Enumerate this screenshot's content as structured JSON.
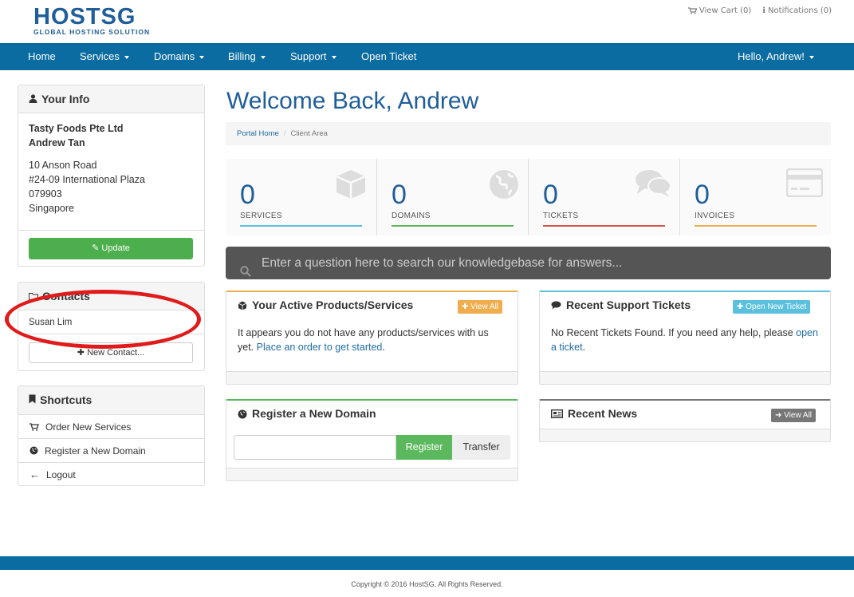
{
  "logo": {
    "main": "HOSTSG",
    "sub": "GLOBAL HOSTING SOLUTION"
  },
  "toplinks": {
    "cart": "View Cart (0)",
    "notifications": "Notifications (0)"
  },
  "nav": {
    "items": [
      {
        "label": "Home"
      },
      {
        "label": "Services"
      },
      {
        "label": "Domains"
      },
      {
        "label": "Billing"
      },
      {
        "label": "Support"
      },
      {
        "label": "Open Ticket"
      }
    ],
    "user": "Hello, Andrew!"
  },
  "your_info": {
    "title": "Your Info",
    "company": "Tasty Foods Pte Ltd",
    "name": "Andrew Tan",
    "address1": "10 Anson Road",
    "address2": "#24-09 International Plaza",
    "postcode": "079903",
    "country": "Singapore",
    "update_label": "Update"
  },
  "contacts": {
    "title": "Contacts",
    "items": [
      {
        "name": "Susan Lim"
      }
    ],
    "new_label": "New Contact..."
  },
  "shortcuts": {
    "title": "Shortcuts",
    "items": [
      {
        "label": "Order New Services",
        "icon": "cart-icon"
      },
      {
        "label": "Register a New Domain",
        "icon": "globe-icon"
      },
      {
        "label": "Logout",
        "icon": "arrow-left-icon"
      }
    ]
  },
  "welcome": "Welcome Back, Andrew",
  "breadcrumb": {
    "home": "Portal Home",
    "current": "Client Area"
  },
  "stats": [
    {
      "value": "0",
      "label": "SERVICES",
      "color": "#5bc0de"
    },
    {
      "value": "0",
      "label": "DOMAINS",
      "color": "#5cb85c"
    },
    {
      "value": "0",
      "label": "TICKETS",
      "color": "#d9534f"
    },
    {
      "value": "0",
      "label": "INVOICES",
      "color": "#f0ad4e"
    }
  ],
  "kb_placeholder": "Enter a question here to search our knowledgebase for answers...",
  "products": {
    "title": "Your Active Products/Services",
    "view_all": "View All",
    "text": "It appears you do not have any products/services with us yet.",
    "link": "Place an order to get started",
    "accent": "#f0ad4e"
  },
  "tickets": {
    "title": "Recent Support Tickets",
    "button": "Open New Ticket",
    "text": "No Recent Tickets Found. If you need any help, please",
    "link": "open a ticket",
    "accent": "#5bc0de"
  },
  "domain_reg": {
    "title": "Register a New Domain",
    "register": "Register",
    "transfer": "Transfer",
    "accent": "#5cb85c"
  },
  "news": {
    "title": "Recent News",
    "view_all": "View All",
    "accent": "#777777"
  },
  "footer": {
    "copyright": "Copyright © 2016 HostSG. All Rights Reserved."
  }
}
